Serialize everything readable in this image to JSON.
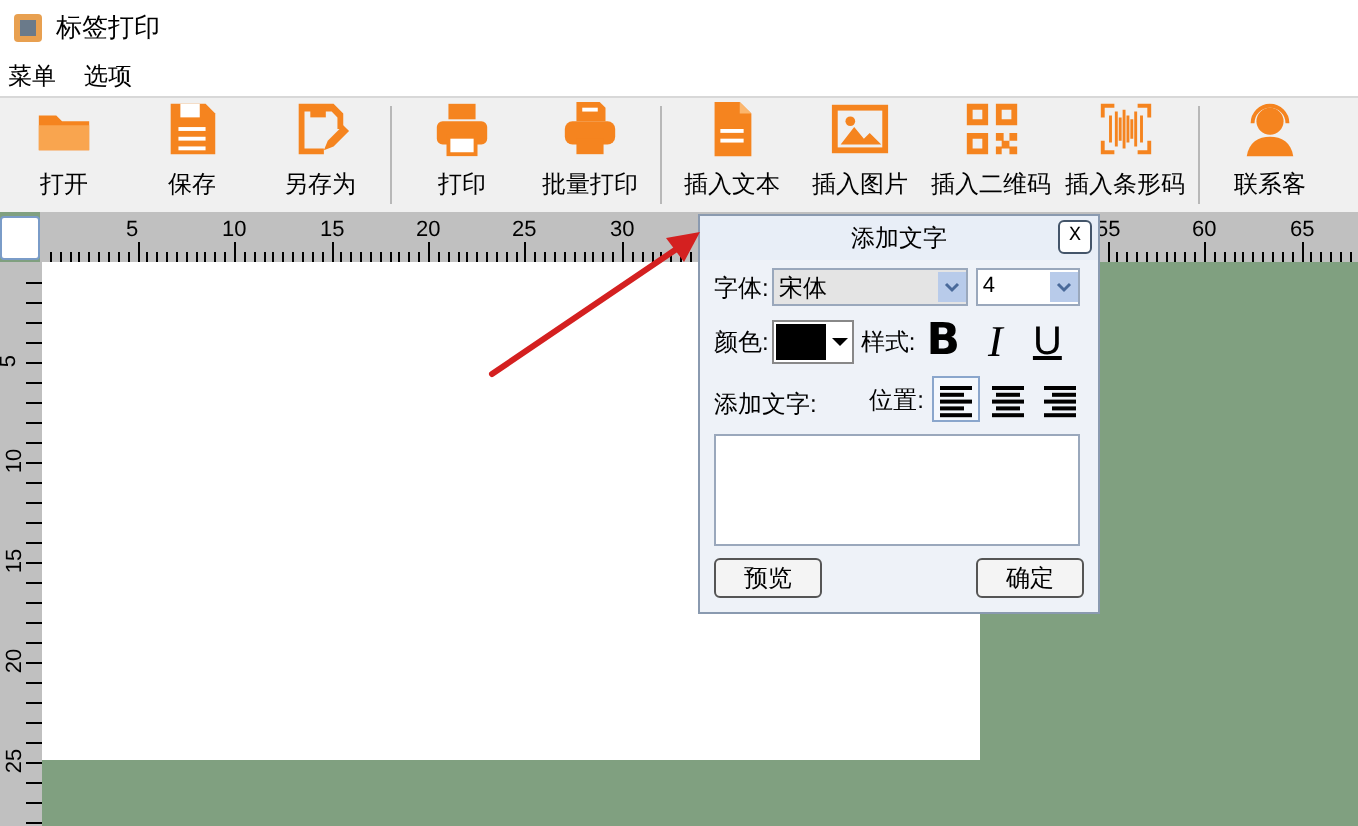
{
  "window": {
    "title": "标签打印"
  },
  "menu": [
    "菜单",
    "选项"
  ],
  "toolbar": [
    {
      "kind": "open",
      "label": "打开"
    },
    {
      "kind": "save",
      "label": "保存"
    },
    {
      "kind": "saveas",
      "label": "另存为"
    },
    {
      "kind": "separator"
    },
    {
      "kind": "print",
      "label": "打印"
    },
    {
      "kind": "batch",
      "label": "批量打印"
    },
    {
      "kind": "separator"
    },
    {
      "kind": "text",
      "label": "插入文本"
    },
    {
      "kind": "image",
      "label": "插入图片"
    },
    {
      "kind": "qrcode",
      "label": "插入二维码"
    },
    {
      "kind": "barcode",
      "label": "插入条形码"
    },
    {
      "kind": "separator"
    },
    {
      "kind": "support",
      "label": "联系客"
    }
  ],
  "ruler": {
    "top_labels": [
      "5",
      "10",
      "15",
      "20",
      "25",
      "30",
      "55",
      "60",
      "65"
    ],
    "left_labels": [
      "5",
      "10",
      "15",
      "20",
      "25"
    ]
  },
  "dialog": {
    "title": "添加文字",
    "close": "X",
    "font_label": "字体:",
    "font_value": "宋体",
    "size_value": "4",
    "color_label": "颜色:",
    "color": "#000000",
    "style_label": "样式:",
    "styles": [
      {
        "kind": "bold",
        "label": "B"
      },
      {
        "kind": "italic",
        "label": "I"
      },
      {
        "kind": "underline",
        "label": "U"
      }
    ],
    "text_label": "添加文字:",
    "position_label": "位置:",
    "alignments": [
      {
        "kind": "left",
        "selected": true
      },
      {
        "kind": "center",
        "selected": false
      },
      {
        "kind": "right",
        "selected": false
      }
    ],
    "buttons": [
      "预览",
      "确定"
    ]
  }
}
